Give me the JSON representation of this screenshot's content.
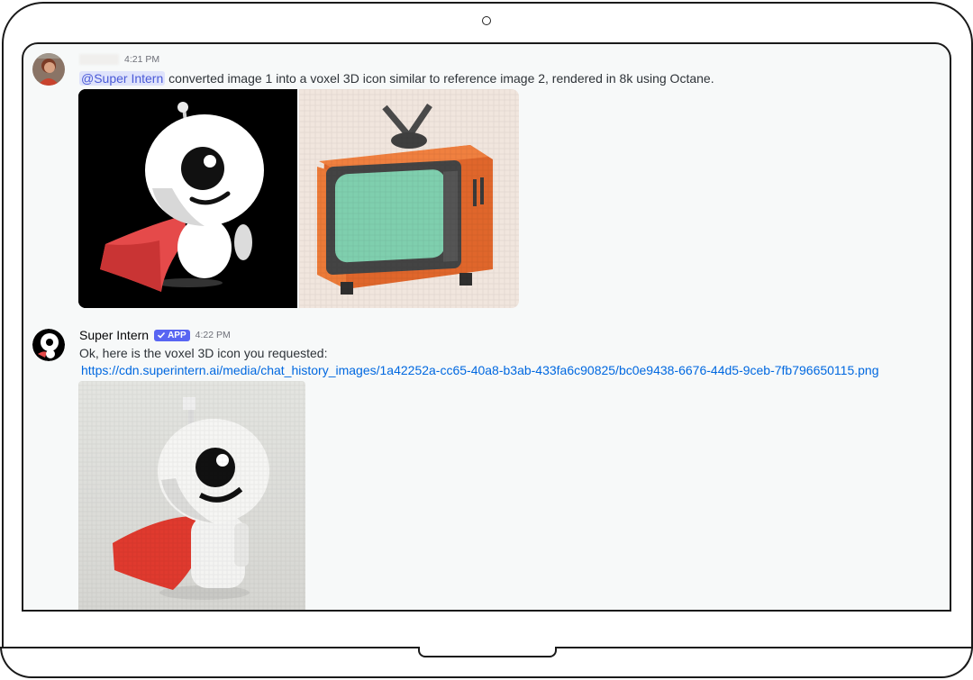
{
  "messages": [
    {
      "author_hidden": true,
      "timestamp": "4:21 PM",
      "mention": "@Super Intern",
      "text": "converted image 1 into a voxel 3D icon similar to reference image 2, rendered in 8k using Octane.",
      "attachments": [
        "superhero-robot-image",
        "retro-tv-voxel-image"
      ]
    },
    {
      "author": "Super Intern",
      "badge": "APP",
      "timestamp": "4:22 PM",
      "text": "Ok, here is the voxel 3D icon you requested:",
      "link": "https://cdn.superintern.ai/media/chat_history_images/1a42252a-cc65-40a8-b3ab-433fa6c90825/bc0e9438-6676-44d5-9ceb-7fb796650115.png",
      "attachments": [
        "voxel-robot-image"
      ]
    }
  ],
  "colors": {
    "mention_bg": "#dfe3fb",
    "mention_text": "#4a5ad7",
    "link": "#0068e0",
    "badge": "#5865f2",
    "screen_bg": "#f7f9f9"
  }
}
